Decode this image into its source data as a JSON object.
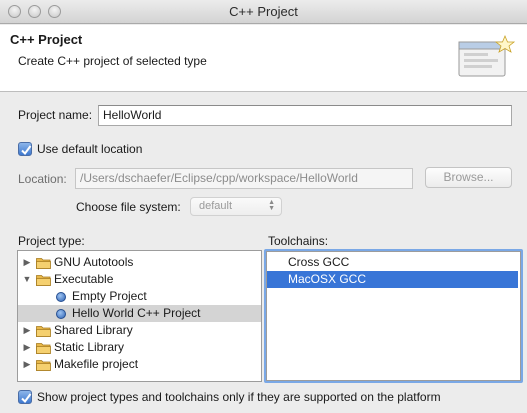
{
  "window": {
    "title": "C++ Project"
  },
  "header": {
    "title": "C++ Project",
    "subtitle": "Create C++ project of selected type",
    "icon": "new-project-wizard-icon"
  },
  "project_name": {
    "label": "Project name:",
    "value": "HelloWorld"
  },
  "use_default_location": {
    "label": "Use default location",
    "checked": true
  },
  "location": {
    "label": "Location:",
    "value": "/Users/dschaefer/Eclipse/cpp/workspace/HelloWorld",
    "browse_label": "Browse..."
  },
  "file_system": {
    "label": "Choose file system:",
    "value": "default"
  },
  "project_type": {
    "label": "Project type:",
    "items": [
      {
        "label": "GNU Autotools",
        "kind": "folder",
        "expanded": false,
        "level": 0
      },
      {
        "label": "Executable",
        "kind": "folder",
        "expanded": true,
        "level": 0
      },
      {
        "label": "Empty Project",
        "kind": "leaf",
        "level": 1
      },
      {
        "label": "Hello World C++ Project",
        "kind": "leaf",
        "level": 1,
        "selected": true
      },
      {
        "label": "Shared Library",
        "kind": "folder",
        "expanded": false,
        "level": 0
      },
      {
        "label": "Static Library",
        "kind": "folder",
        "expanded": false,
        "level": 0
      },
      {
        "label": "Makefile project",
        "kind": "folder",
        "expanded": false,
        "level": 0
      }
    ]
  },
  "toolchains": {
    "label": "Toolchains:",
    "items": [
      {
        "label": "Cross GCC",
        "selected": false
      },
      {
        "label": "MacOSX GCC",
        "selected": true
      }
    ]
  },
  "show_supported_only": {
    "label": "Show project types and toolchains only if they are supported on the platform",
    "checked": true
  },
  "colors": {
    "selection": "#3875d7",
    "inactive_selection": "#d4d4d4",
    "checkbox": "#3d78cf",
    "folder": "#e8b84a"
  }
}
